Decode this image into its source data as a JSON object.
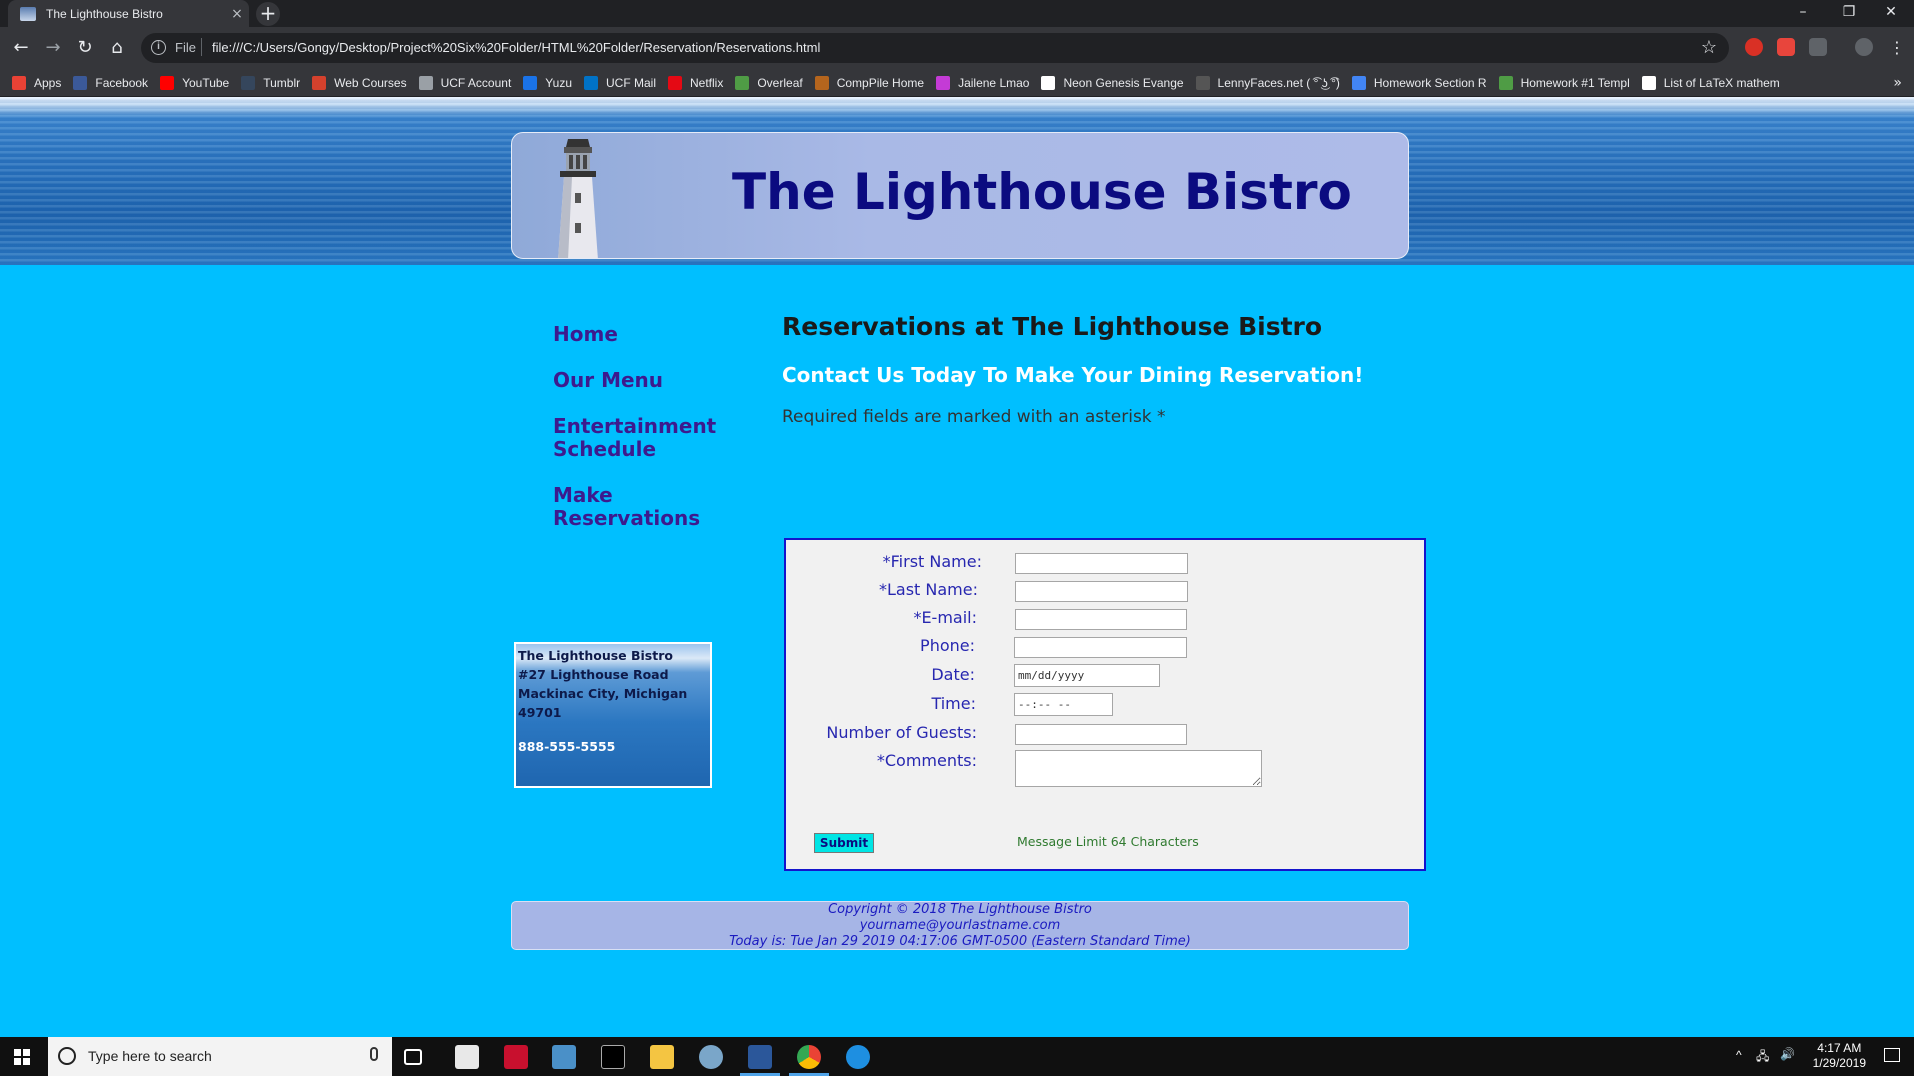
{
  "browser": {
    "tab_title": "The Lighthouse Bistro",
    "tab_close": "×",
    "new_tab": "+",
    "scheme": "File",
    "url": "file:///C:/Users/Gongy/Desktop/Project%20Six%20Folder/HTML%20Folder/Reservation/Reservations.html",
    "window_controls": [
      "–",
      "❐",
      "✕"
    ],
    "bookmarks": [
      {
        "label": "Apps",
        "icon": "apps-grid-icon",
        "color": "#e94235"
      },
      {
        "label": "Facebook",
        "icon": "facebook-icon",
        "color": "#3b5998"
      },
      {
        "label": "YouTube",
        "icon": "youtube-icon",
        "color": "#ff0000"
      },
      {
        "label": "Tumblr",
        "icon": "tumblr-icon",
        "color": "#35465c"
      },
      {
        "label": "Web Courses",
        "icon": "web-courses-icon",
        "color": "#d4412d"
      },
      {
        "label": "UCF Account",
        "icon": "page-icon",
        "color": "#9aa0a6"
      },
      {
        "label": "Yuzu",
        "icon": "yuzu-icon",
        "color": "#1a73e8"
      },
      {
        "label": "UCF Mail",
        "icon": "outlook-icon",
        "color": "#0072c6"
      },
      {
        "label": "Netflix",
        "icon": "netflix-icon",
        "color": "#e50914"
      },
      {
        "label": "Overleaf",
        "icon": "overleaf-icon",
        "color": "#4f9c45"
      },
      {
        "label": "CompPile Home",
        "icon": "comppile-icon",
        "color": "#b5651d"
      },
      {
        "label": "Jailene Lmao",
        "icon": "jailene-icon",
        "color": "#c43bd6"
      },
      {
        "label": "Neon Genesis Evange",
        "icon": "wikipedia-icon",
        "color": "#ffffff"
      },
      {
        "label": "LennyFaces.net ( ͡° ͜ʖ ͡°)",
        "icon": "lenny-icon",
        "color": "#555555"
      },
      {
        "label": "Homework Section R",
        "icon": "doc-icon",
        "color": "#4285f4"
      },
      {
        "label": "Homework #1 Templ",
        "icon": "overleaf-icon",
        "color": "#4f9c45"
      },
      {
        "label": "List of LaTeX mathem",
        "icon": "wikipedia-icon",
        "color": "#ffffff"
      }
    ],
    "bookmarks_more": "»"
  },
  "site": {
    "title": "The Lighthouse Bistro",
    "nav": {
      "home": "Home",
      "menu": "Our Menu",
      "entertainment": "Entertainment Schedule",
      "reservations": "Make Reservations"
    },
    "address": {
      "name": "The Lighthouse Bistro",
      "street": "#27 Lighthouse Road",
      "city": "Mackinac City, Michigan",
      "zip": "49701",
      "phone": "888-555-5555"
    },
    "heading": "Reservations at The Lighthouse Bistro",
    "subheading": "Contact Us Today To Make Your Dining Reservation!",
    "required_note": "Required fields are marked with an asterisk *",
    "form": {
      "first_name_label": "*First Name:",
      "last_name_label": "*Last Name:",
      "email_label": "*E-mail:",
      "phone_label": "Phone:",
      "date_label": "Date:",
      "date_placeholder": "mm/dd/yyyy",
      "time_label": "Time:",
      "time_placeholder": "--:-- --",
      "guests_label": "Number of Guests:",
      "comments_label": "*Comments:",
      "submit_label": "Submit",
      "message_limit": "Message Limit 64 Characters"
    },
    "footer": {
      "copyright": "Copyright © 2018 The Lighthouse Bistro",
      "email": "yourname@yourlastname.com",
      "today": "Today is: Tue Jan 29 2019 04:17:06 GMT-0500 (Eastern Standard Time)"
    }
  },
  "taskbar": {
    "search_placeholder": "Type here to search",
    "time": "4:17 AM",
    "date": "1/29/2019"
  },
  "colors": {
    "page_background": "#00bfff",
    "title_color": "#0b0b80",
    "nav_color": "#3d1a8e",
    "form_label_color": "#2727b0",
    "form_border": "#1414cc",
    "submit_bg": "#00e5e5",
    "message_limit_color": "#2f7a2f"
  }
}
